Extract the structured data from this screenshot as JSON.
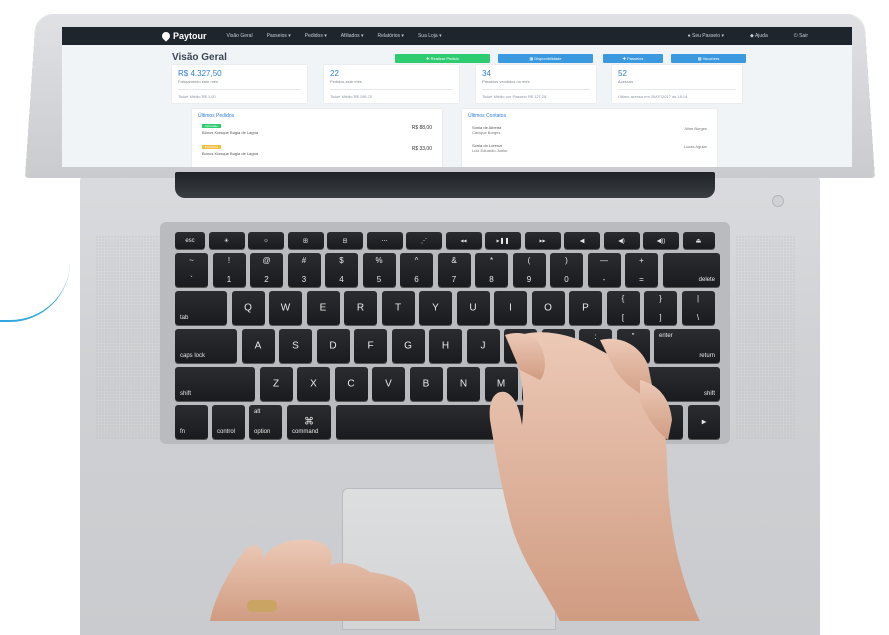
{
  "dashboard": {
    "brand": "Paytour",
    "nav_items": [
      "Visão Geral",
      "Passeios ▾",
      "Pedidos ▾",
      "Afiliados ▾",
      "Relatórios ▾",
      "Sua Loja ▾"
    ],
    "nav_right": [
      "● Seu Passeio ▾",
      "◆ Ajuda",
      "⏻ Sair"
    ],
    "title": "Visão Geral",
    "actions": [
      {
        "label": "✚ Realizar Pedido",
        "color": "#2ecc71"
      },
      {
        "label": "▦ Disponibilidade",
        "color": "#3b99e0"
      },
      {
        "label": "✚ Passeios",
        "color": "#3b99e0"
      },
      {
        "label": "▦ Vouchers",
        "color": "#3b99e0"
      }
    ],
    "stats": [
      {
        "big": "R$ 4.327,50",
        "sub": "Faturamento este mês",
        "foot": "Ticket Médio R$ 1,00"
      },
      {
        "big": "22",
        "sub": "Pedidos este mês",
        "foot": "Ticket Médio R$ 196,70"
      },
      {
        "big": "34",
        "sub": "Passeios vendidos no mês",
        "foot": "Ticket Médio por Passeio R$ 127,28"
      },
      {
        "big": "52",
        "sub": "Acessos",
        "foot": "Último acesso em 26/07/2017 às 18:14"
      }
    ],
    "orders": {
      "title": "Últimos Pedidos",
      "items": [
        {
          "tag": "Aprovado",
          "name": "Bônus Kiosque Bugia de Lagoa",
          "value": "R$ 88,00"
        },
        {
          "tag": "Pendente",
          "name": "Bonus Kiosque Bugia de Lagoa",
          "value": "R$ 33,00"
        }
      ]
    },
    "contacts": {
      "title": "Últimos Contatos",
      "items": [
        {
          "name": "Sonia de Alberta",
          "detail": "Cacique Borges",
          "right": "Aline Borges"
        },
        {
          "name": "Sonia do Lorenzi",
          "detail": "Luiz Eduardo Junior",
          "right": "Lucas Aguiar"
        }
      ]
    }
  },
  "keyboard": {
    "fn_row": [
      "esc",
      "☀",
      "☼",
      "⊞",
      "⊟",
      "⋯",
      "⋰",
      "◂◂",
      "▸❚❚",
      "▸▸",
      "◀",
      "◀)",
      "◀))",
      "⏏"
    ],
    "num_row": [
      [
        "~",
        "`"
      ],
      [
        "!",
        "1"
      ],
      [
        "@",
        "2"
      ],
      [
        "#",
        "3"
      ],
      [
        "$",
        "4"
      ],
      [
        "%",
        "5"
      ],
      [
        "^",
        "6"
      ],
      [
        "&",
        "7"
      ],
      [
        "*",
        "8"
      ],
      [
        "(",
        "9"
      ],
      [
        ")",
        "0"
      ],
      [
        "—",
        "-"
      ],
      [
        "+",
        "="
      ]
    ],
    "delete": "delete",
    "tab": "tab",
    "qrow": [
      "Q",
      "W",
      "E",
      "R",
      "T",
      "Y",
      "U",
      "I",
      "O",
      "P"
    ],
    "qrow_sym": [
      [
        "{",
        "["
      ],
      [
        "}",
        "]"
      ],
      [
        "|",
        "\\"
      ]
    ],
    "caps": "caps lock",
    "arow": [
      "A",
      "S",
      "D",
      "F",
      "G",
      "H",
      "J",
      "K",
      "L"
    ],
    "arow_sym": [
      [
        ":",
        ";"
      ],
      [
        "\"",
        "'"
      ]
    ],
    "enter_top": "enter",
    "enter_bot": "return",
    "shift": "shift",
    "zrow": [
      "Z",
      "X",
      "C",
      "V",
      "B",
      "N",
      "M"
    ],
    "shift_r": "shift",
    "fn": "fn",
    "control": "control",
    "alt_top": "alt",
    "option": "option",
    "cmd_sym": "⌘",
    "command": "command",
    "arrow_right": "▶"
  }
}
